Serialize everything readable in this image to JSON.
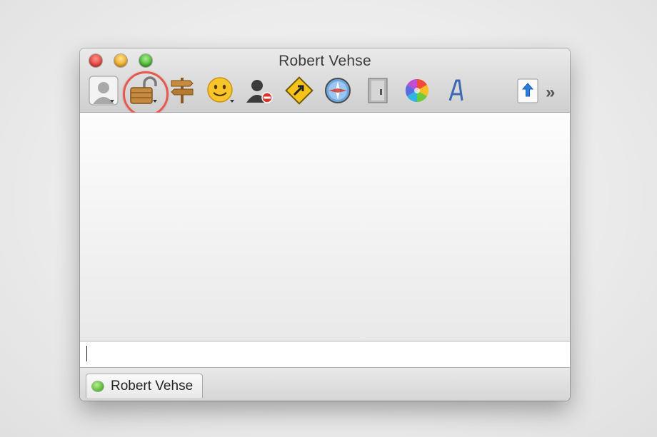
{
  "window": {
    "title": "Robert Vehse"
  },
  "toolbar": {
    "icons": [
      "avatar-icon",
      "lock-icon",
      "signpost-icon",
      "smiley-icon",
      "block-user-icon",
      "send-file-icon",
      "compass-icon",
      "door-icon",
      "color-wheel-icon",
      "font-icon",
      "share-icon"
    ],
    "overflow_label": "»",
    "highlighted": "lock-icon",
    "highlight_color": "#e35b50"
  },
  "message_input": {
    "value": ""
  },
  "tabs": [
    {
      "label": "Robert Vehse",
      "status": "online",
      "status_color": "#4fb22c"
    }
  ]
}
